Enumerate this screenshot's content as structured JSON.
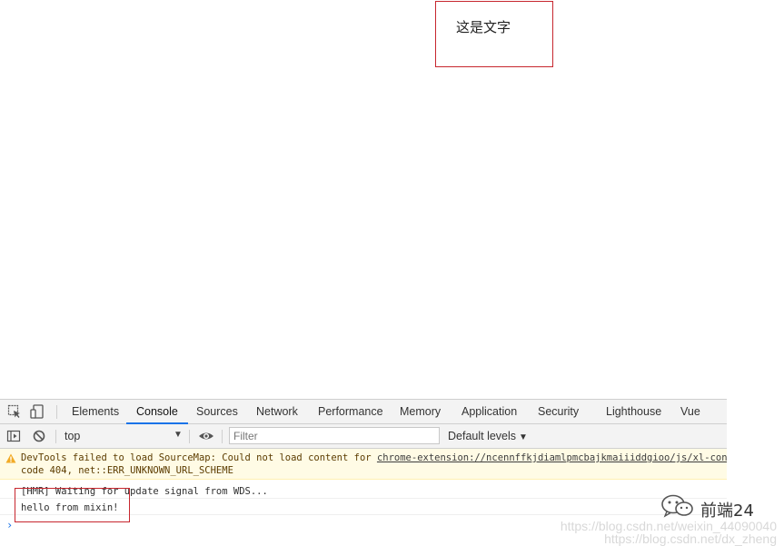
{
  "page": {
    "content_text": "这是文字"
  },
  "devtools": {
    "tabs": [
      {
        "label": "Elements"
      },
      {
        "label": "Console",
        "active": true
      },
      {
        "label": "Sources"
      },
      {
        "label": "Network"
      },
      {
        "label": "Performance"
      },
      {
        "label": "Memory"
      },
      {
        "label": "Application"
      },
      {
        "label": "Security"
      },
      {
        "label": "Lighthouse"
      },
      {
        "label": "Vue"
      }
    ],
    "toolbar": {
      "context": "top",
      "filter_placeholder": "Filter",
      "levels": "Default levels"
    },
    "console": {
      "warning": {
        "prefix": "DevTools failed to load SourceMap: Could not load content for ",
        "link": "chrome-extension://ncennffkjdiamlpmcbajkmaiiiddgioo/js/xl-content.js.map: HTTP error: status",
        "line2": "code 404, net::ERR_UNKNOWN_URL_SCHEME"
      },
      "messages": [
        {
          "text": "[HMR] Waiting for update signal from WDS..."
        },
        {
          "text": "hello from mixin!"
        }
      ],
      "prompt": "›"
    },
    "accent_color": "#1a73e8",
    "highlight_color": "#c7262e"
  },
  "watermark": {
    "brand": "前端24",
    "url1": "https://blog.csdn.net/weixin_44090040",
    "url2": "https://blog.csdn.net/dx_zheng"
  }
}
